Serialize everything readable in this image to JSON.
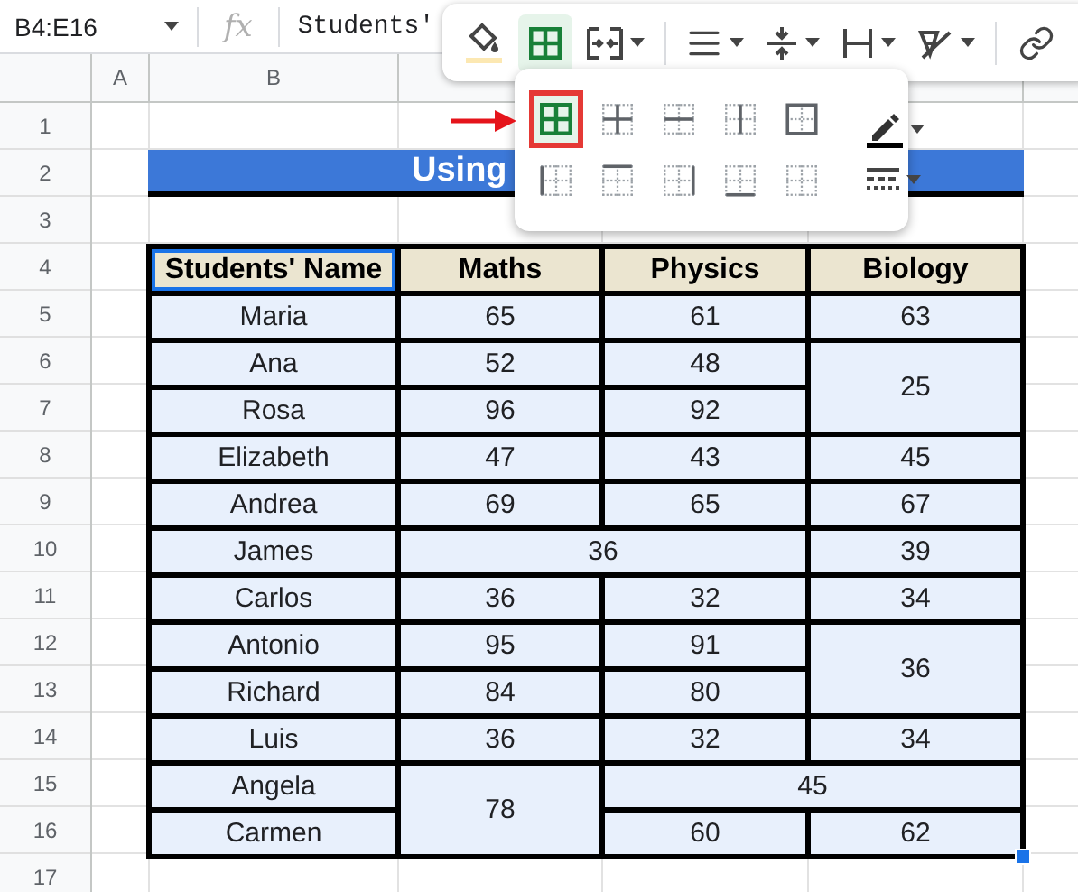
{
  "formula_bar": {
    "name_box": "B4:E16",
    "fx": "fx",
    "content": "Students'"
  },
  "toolbar": {
    "borders_pressed": true
  },
  "border_menu": {
    "options": [
      {
        "selected": true
      },
      {
        "selected": false
      },
      {
        "selected": false
      },
      {
        "selected": false
      },
      {
        "selected": false
      },
      {
        "selected": false
      },
      {
        "selected": false
      },
      {
        "selected": false
      },
      {
        "selected": false
      },
      {
        "selected": false
      }
    ]
  },
  "column_headers": [
    "A",
    "B"
  ],
  "row_headers": [
    "1",
    "2",
    "3",
    "4",
    "5",
    "6",
    "7",
    "8",
    "9",
    "10",
    "11",
    "12",
    "13",
    "14",
    "15",
    "16",
    "17"
  ],
  "title": "Using",
  "table": {
    "columns": [
      {
        "label": "Students' Name",
        "active": true
      },
      {
        "label": "Maths",
        "active": false
      },
      {
        "label": "Physics",
        "active": false
      },
      {
        "label": "Biology",
        "active": false
      }
    ],
    "rows": [
      {
        "cells": [
          {
            "text": "Maria"
          },
          {
            "text": "65"
          },
          {
            "text": "61"
          },
          {
            "text": "63"
          }
        ]
      },
      {
        "cells": [
          {
            "text": "Ana"
          },
          {
            "text": "52"
          },
          {
            "text": "48"
          },
          {
            "text": "25",
            "merged_down": true
          }
        ]
      },
      {
        "cells": [
          {
            "text": "Rosa"
          },
          {
            "text": "96"
          },
          {
            "text": "92"
          },
          {
            "text": ""
          }
        ]
      },
      {
        "cells": [
          {
            "text": "Elizabeth"
          },
          {
            "text": "47"
          },
          {
            "text": "43"
          },
          {
            "text": "45"
          }
        ]
      },
      {
        "cells": [
          {
            "text": "Andrea"
          },
          {
            "text": "69"
          },
          {
            "text": "65"
          },
          {
            "text": "67"
          }
        ]
      },
      {
        "cells": [
          {
            "text": "James"
          },
          {
            "text": "36",
            "merged_across": true
          },
          {
            "text": ""
          },
          {
            "text": "39"
          }
        ]
      },
      {
        "cells": [
          {
            "text": "Carlos"
          },
          {
            "text": "36"
          },
          {
            "text": "32"
          },
          {
            "text": "34"
          }
        ]
      },
      {
        "cells": [
          {
            "text": "Antonio"
          },
          {
            "text": "95"
          },
          {
            "text": "91"
          },
          {
            "text": "36",
            "merged_down": true
          }
        ]
      },
      {
        "cells": [
          {
            "text": "Richard"
          },
          {
            "text": "84"
          },
          {
            "text": "80"
          },
          {
            "text": ""
          }
        ]
      },
      {
        "cells": [
          {
            "text": "Luis"
          },
          {
            "text": "36"
          },
          {
            "text": "32"
          },
          {
            "text": "34"
          }
        ]
      },
      {
        "cells": [
          {
            "text": "Angela"
          },
          {
            "text": "78",
            "merged_down": true
          },
          {
            "text": "45",
            "merged_across": true
          },
          {
            "text": ""
          }
        ]
      },
      {
        "cells": [
          {
            "text": "Carmen"
          },
          {
            "text": ""
          },
          {
            "text": "60"
          },
          {
            "text": "62"
          }
        ]
      }
    ]
  }
}
